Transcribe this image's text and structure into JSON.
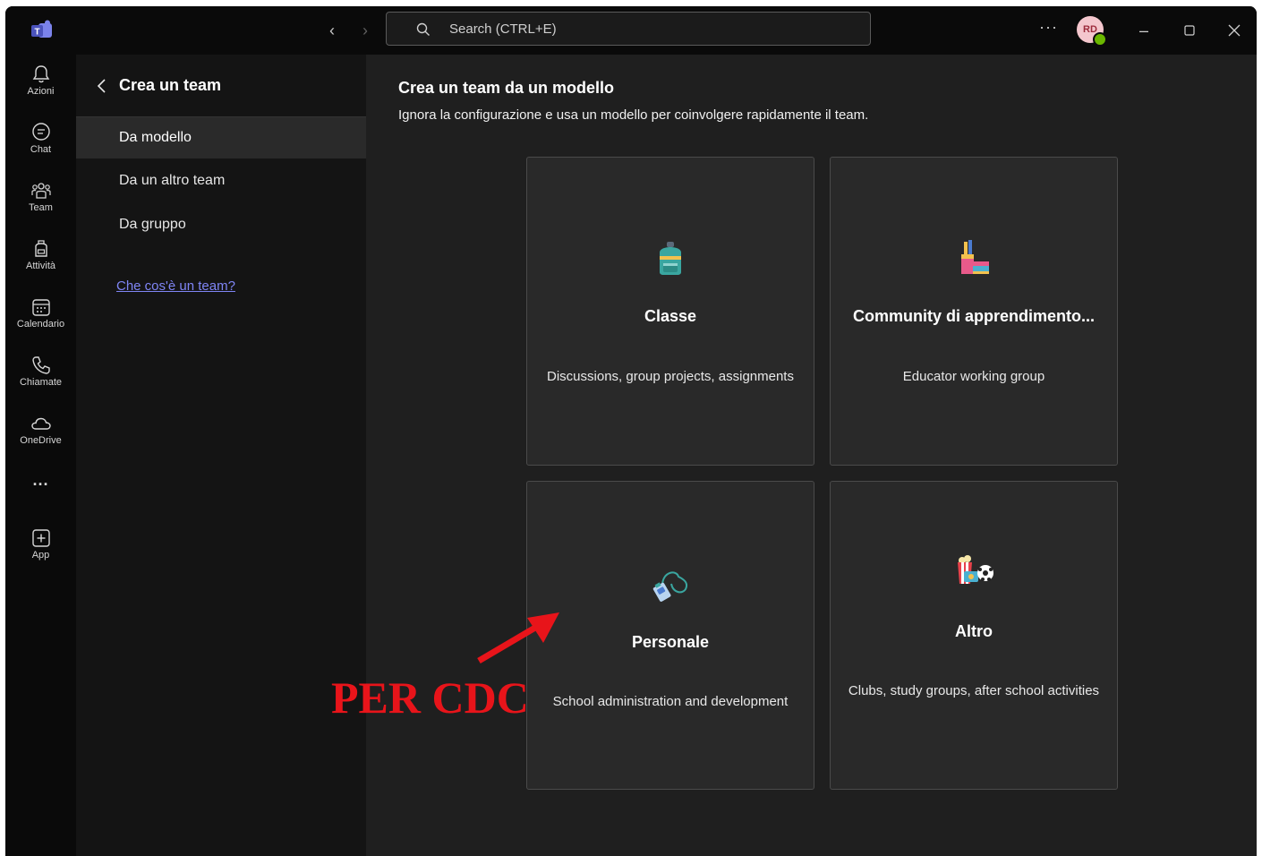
{
  "titlebar": {
    "search_placeholder": "Search (CTRL+E)",
    "more_label": "···",
    "avatar_initials": "RD"
  },
  "rail": {
    "items": [
      {
        "label": "Azioni",
        "icon": "bell-icon"
      },
      {
        "label": "Chat",
        "icon": "chat-icon"
      },
      {
        "label": "Team",
        "icon": "team-icon"
      },
      {
        "label": "Attività",
        "icon": "backpack-icon"
      },
      {
        "label": "Calendario",
        "icon": "calendar-icon"
      },
      {
        "label": "Chiamate",
        "icon": "phone-icon"
      },
      {
        "label": "OneDrive",
        "icon": "cloud-icon"
      },
      {
        "label": "App",
        "icon": "add-app-icon"
      }
    ],
    "more_label": "···"
  },
  "sidebar": {
    "title": "Crea un team",
    "items": [
      {
        "label": "Da modello"
      },
      {
        "label": "Da un altro team"
      },
      {
        "label": "Da gruppo"
      }
    ],
    "help_link": "Che cos'è un team?"
  },
  "main": {
    "title": "Crea un team da un modello",
    "subtitle": "Ignora la configurazione e usa un modello per coinvolgere rapidamente il team.",
    "cards": [
      {
        "title": "Classe",
        "description": "Discussions, group projects, assignments",
        "icon": "backpack-icon"
      },
      {
        "title": "Community di apprendimento...",
        "description": "Educator working group",
        "icon": "school-supplies-icon"
      },
      {
        "title": "Personale",
        "description": "School administration and development",
        "icon": "lanyard-badge-icon"
      },
      {
        "title": "Altro",
        "description": "Clubs, study groups, after school activities",
        "icon": "popcorn-ball-icon"
      }
    ]
  },
  "annotation": {
    "text": "PER CDC",
    "color": "#e8141a"
  },
  "colors": {
    "accent_link": "#7f85f5",
    "presence_available": "#6bb700"
  }
}
